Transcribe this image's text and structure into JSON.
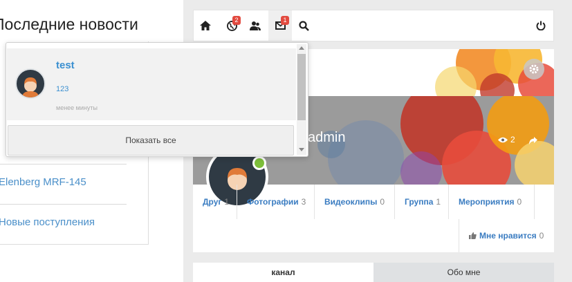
{
  "left": {
    "title": "Последние новости",
    "links": [
      "Elenberg MRF-145",
      "Новые поступления"
    ]
  },
  "toolbar": {
    "buttons": [
      {
        "icon": "home-icon"
      },
      {
        "icon": "globe-icon",
        "badge": "2"
      },
      {
        "icon": "users-icon"
      },
      {
        "icon": "envelope-icon",
        "badge": "1"
      },
      {
        "icon": "search-icon"
      },
      {
        "icon": "power-icon"
      }
    ]
  },
  "profile": {
    "name": "admin",
    "views": "2"
  },
  "stats": [
    {
      "label": "Друг",
      "count": "1"
    },
    {
      "label": "Фотографии",
      "count": "3"
    },
    {
      "label": "Видеоклипы",
      "count": "0"
    },
    {
      "label": "Группа",
      "count": "1"
    },
    {
      "label": "Мероприятия",
      "count": "0"
    }
  ],
  "like": {
    "label": "Мне нравится",
    "count": "0"
  },
  "tabs": [
    "канал",
    "Обо мне"
  ],
  "popup": {
    "user": "test",
    "message": "123",
    "time": "менее минуты",
    "show_all": "Показать все"
  }
}
